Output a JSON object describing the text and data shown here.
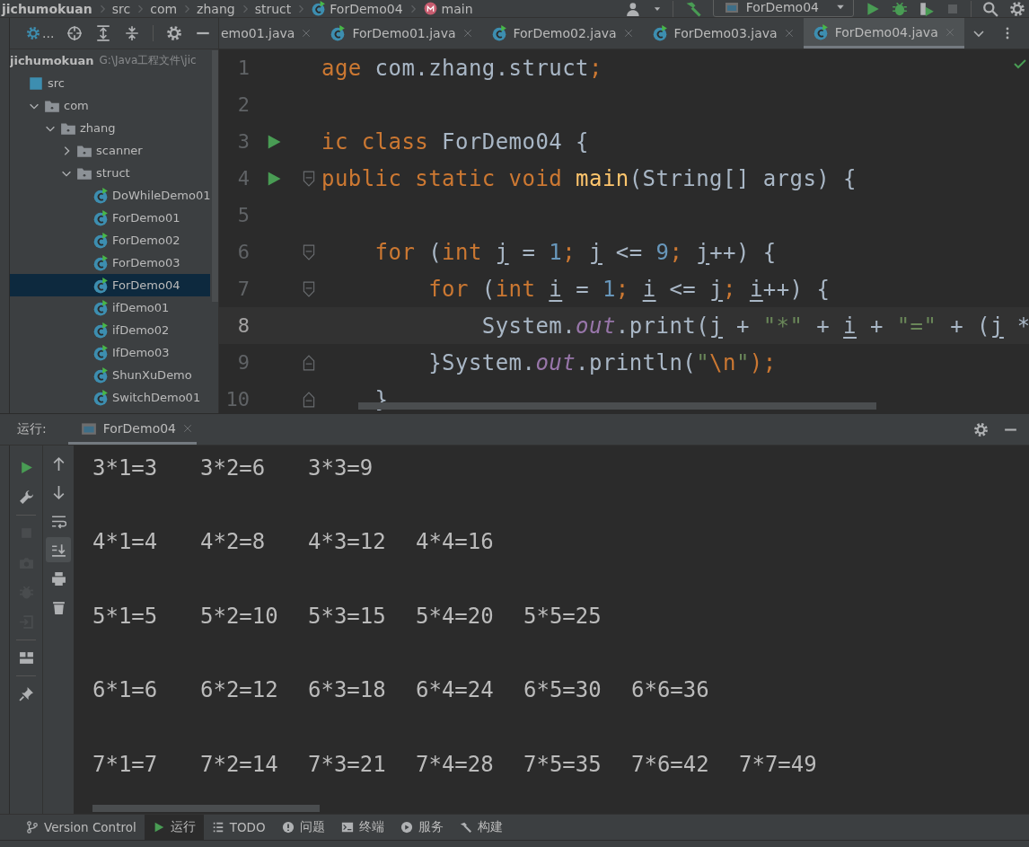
{
  "breadcrumbs": [
    {
      "label": "jichumokuan",
      "kind": "project"
    },
    {
      "label": "src",
      "kind": "folder"
    },
    {
      "label": "com",
      "kind": "folder"
    },
    {
      "label": "zhang",
      "kind": "folder"
    },
    {
      "label": "struct",
      "kind": "folder"
    },
    {
      "label": "ForDemo04",
      "kind": "class"
    },
    {
      "label": "main",
      "kind": "method"
    }
  ],
  "run_config": "ForDemo04",
  "project_toolbar": {
    "more": "..."
  },
  "tabs": [
    {
      "label": "emo01.java",
      "selected": false
    },
    {
      "label": "ForDemo01.java",
      "selected": false
    },
    {
      "label": "ForDemo02.java",
      "selected": false
    },
    {
      "label": "ForDemo03.java",
      "selected": false
    },
    {
      "label": "ForDemo04.java",
      "selected": true
    }
  ],
  "project_tree": [
    {
      "label": "jichumokuan",
      "kind": "module",
      "path": "G:\\Java工程文件\\jic",
      "children": [
        {
          "label": "src",
          "kind": "source",
          "children": [
            {
              "label": "com",
              "kind": "package",
              "expanded": true,
              "children": [
                {
                  "label": "zhang",
                  "kind": "package",
                  "expanded": true,
                  "children": [
                    {
                      "label": "scanner",
                      "kind": "package",
                      "expanded": false
                    },
                    {
                      "label": "struct",
                      "kind": "package",
                      "expanded": true,
                      "children": [
                        {
                          "label": "DoWhileDemo01",
                          "kind": "class",
                          "selected": false
                        },
                        {
                          "label": "ForDemo01",
                          "kind": "class",
                          "selected": false
                        },
                        {
                          "label": "ForDemo02",
                          "kind": "class",
                          "selected": false
                        },
                        {
                          "label": "ForDemo03",
                          "kind": "class",
                          "selected": false
                        },
                        {
                          "label": "ForDemo04",
                          "kind": "class",
                          "selected": true
                        },
                        {
                          "label": "ifDemo01",
                          "kind": "class",
                          "selected": false
                        },
                        {
                          "label": "ifDemo02",
                          "kind": "class",
                          "selected": false
                        },
                        {
                          "label": "IfDemo03",
                          "kind": "class",
                          "selected": false
                        },
                        {
                          "label": "ShunXuDemo",
                          "kind": "class",
                          "selected": false
                        },
                        {
                          "label": "SwitchDemo01",
                          "kind": "class",
                          "selected": false
                        }
                      ]
                    }
                  ]
                }
              ]
            }
          ]
        }
      ]
    }
  ],
  "code_lines": [
    {
      "number": "1",
      "tokens": [
        {
          "text": "age",
          "kind": "keyword"
        },
        {
          "text": " com.zhang.struct",
          "kind": "plain"
        },
        {
          "text": ";",
          "kind": "keyword"
        }
      ]
    },
    {
      "number": "2"
    },
    {
      "number": "3",
      "run": true,
      "tokens": [
        {
          "text": "ic class",
          "kind": "keyword"
        },
        {
          "text": " ForDemo04 {",
          "kind": "plain"
        }
      ]
    },
    {
      "number": "4",
      "run": true,
      "fold_open": true,
      "tokens": [
        {
          "text": "public static void ",
          "kind": "keyword"
        },
        {
          "text": "main",
          "kind": "function"
        },
        {
          "text": "(String[] args) {",
          "kind": "plain"
        }
      ]
    },
    {
      "number": "5"
    },
    {
      "number": "6",
      "fold_open": true,
      "tokens": [
        {
          "text": "    for",
          "kind": "keyword"
        },
        {
          "text": " (",
          "kind": "plain"
        },
        {
          "text": "int ",
          "kind": "keyword"
        },
        {
          "text": "j",
          "kind": "variable"
        },
        {
          "text": " = ",
          "kind": "plain"
        },
        {
          "text": "1",
          "kind": "number"
        },
        {
          "text": "; ",
          "kind": "keyword"
        },
        {
          "text": "j",
          "kind": "variable"
        },
        {
          "text": " <= ",
          "kind": "plain"
        },
        {
          "text": "9",
          "kind": "number"
        },
        {
          "text": "; ",
          "kind": "keyword"
        },
        {
          "text": "j",
          "kind": "variable"
        },
        {
          "text": "++) {",
          "kind": "plain"
        }
      ]
    },
    {
      "number": "7",
      "fold_open": true,
      "tokens": [
        {
          "text": "        for",
          "kind": "keyword"
        },
        {
          "text": " (",
          "kind": "plain"
        },
        {
          "text": "int ",
          "kind": "keyword"
        },
        {
          "text": "i",
          "kind": "variable"
        },
        {
          "text": " = ",
          "kind": "plain"
        },
        {
          "text": "1",
          "kind": "number"
        },
        {
          "text": "; ",
          "kind": "keyword"
        },
        {
          "text": "i",
          "kind": "variable"
        },
        {
          "text": " <= ",
          "kind": "plain"
        },
        {
          "text": "j",
          "kind": "variable"
        },
        {
          "text": "; ",
          "kind": "keyword"
        },
        {
          "text": "i",
          "kind": "variable"
        },
        {
          "text": "++) {",
          "kind": "plain"
        }
      ]
    },
    {
      "number": "8",
      "current": true,
      "tokens": [
        {
          "text": "            System.",
          "kind": "plain"
        },
        {
          "text": "out",
          "kind": "field"
        },
        {
          "text": ".print(",
          "kind": "plain"
        },
        {
          "text": "j",
          "kind": "variable"
        },
        {
          "text": " + ",
          "kind": "plain"
        },
        {
          "text": "\"*\"",
          "kind": "string"
        },
        {
          "text": " + ",
          "kind": "plain"
        },
        {
          "text": "i",
          "kind": "variable"
        },
        {
          "text": " + ",
          "kind": "plain"
        },
        {
          "text": "\"=\"",
          "kind": "string"
        },
        {
          "text": " + (",
          "kind": "plain"
        },
        {
          "text": "j",
          "kind": "variable"
        },
        {
          "text": " *",
          "kind": "plain"
        }
      ]
    },
    {
      "number": "9",
      "fold_close": true,
      "tokens": [
        {
          "text": "        }System.",
          "kind": "plain"
        },
        {
          "text": "out",
          "kind": "field"
        },
        {
          "text": ".println(",
          "kind": "plain"
        },
        {
          "text": "\"",
          "kind": "string"
        },
        {
          "text": "\\n",
          "kind": "escape"
        },
        {
          "text": "\"",
          "kind": "string"
        },
        {
          "text": ");",
          "kind": "keyword"
        }
      ]
    },
    {
      "number": "10",
      "fold_close": true,
      "tokens": [
        {
          "text": "    }",
          "kind": "plain"
        }
      ]
    }
  ],
  "run_panel": {
    "title": "运行:",
    "tab": "ForDemo04",
    "actions": [
      {
        "kind": "run",
        "disabled": false
      },
      {
        "kind": "wrench",
        "disabled": false
      },
      {
        "kind": "separator"
      },
      {
        "kind": "stop",
        "disabled": true
      },
      {
        "kind": "camera",
        "disabled": true
      },
      {
        "kind": "bug",
        "disabled": true
      },
      {
        "kind": "exit",
        "disabled": true
      },
      {
        "kind": "separator"
      },
      {
        "kind": "layout",
        "disabled": false
      },
      {
        "kind": "separator"
      },
      {
        "kind": "pin",
        "disabled": false
      }
    ],
    "console_tools": [
      {
        "kind": "up",
        "selected": false
      },
      {
        "kind": "down",
        "selected": false
      },
      {
        "kind": "wrap",
        "selected": false
      },
      {
        "kind": "scroll-end",
        "selected": true
      },
      {
        "kind": "print",
        "selected": false
      },
      {
        "kind": "trash",
        "selected": false
      }
    ],
    "output": [
      [
        "3*1=3",
        "3*2=6",
        "3*3=9"
      ],
      [
        "4*1=4",
        "4*2=8",
        "4*3=12",
        "4*4=16"
      ],
      [
        "5*1=5",
        "5*2=10",
        "5*3=15",
        "5*4=20",
        "5*5=25"
      ],
      [
        "6*1=6",
        "6*2=12",
        "6*3=18",
        "6*4=24",
        "6*5=30",
        "6*6=36"
      ],
      [
        "7*1=7",
        "7*2=14",
        "7*3=21",
        "7*4=28",
        "7*5=35",
        "7*6=42",
        "7*7=49"
      ]
    ]
  },
  "bottom_tabs": [
    {
      "label": "Version Control",
      "kind": "branch",
      "selected": false
    },
    {
      "label": "运行",
      "kind": "run",
      "selected": true
    },
    {
      "label": "TODO",
      "kind": "list",
      "selected": false
    },
    {
      "label": "问题",
      "kind": "problems",
      "selected": false
    },
    {
      "label": "终端",
      "kind": "terminal",
      "selected": false
    },
    {
      "label": "服务",
      "kind": "services",
      "selected": false
    },
    {
      "label": "构建",
      "kind": "build",
      "selected": false
    }
  ]
}
